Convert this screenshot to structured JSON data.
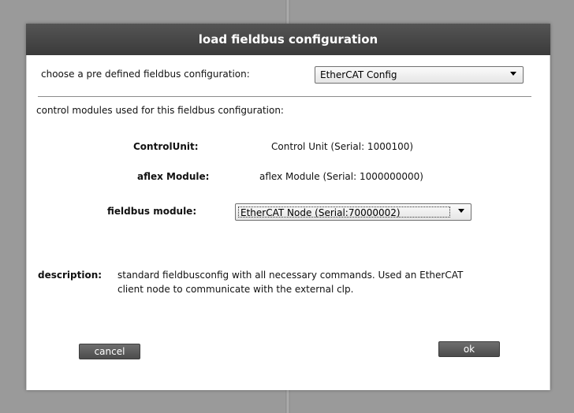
{
  "dialog": {
    "title": "load fieldbus configuration"
  },
  "config": {
    "label": "choose a pre defined fieldbus configuration:",
    "selected": "EtherCAT Config"
  },
  "modules": {
    "heading": "control modules used for this fieldbus configuration:",
    "control_unit_label": "ControlUnit:",
    "control_unit_value": "Control Unit (Serial: 1000100)",
    "aflex_label": "aflex Module:",
    "aflex_value": "aflex Module (Serial: 1000000000)",
    "fieldbus_label": "fieldbus module:",
    "fieldbus_selected": "EtherCAT Node (Serial:70000002)"
  },
  "description": {
    "label": "description:",
    "line1": "standard fieldbusconfig with all necessary commands. Used an EtherCAT",
    "line2": "client node to communicate with the external clp."
  },
  "buttons": {
    "cancel": "cancel",
    "ok": "ok"
  }
}
